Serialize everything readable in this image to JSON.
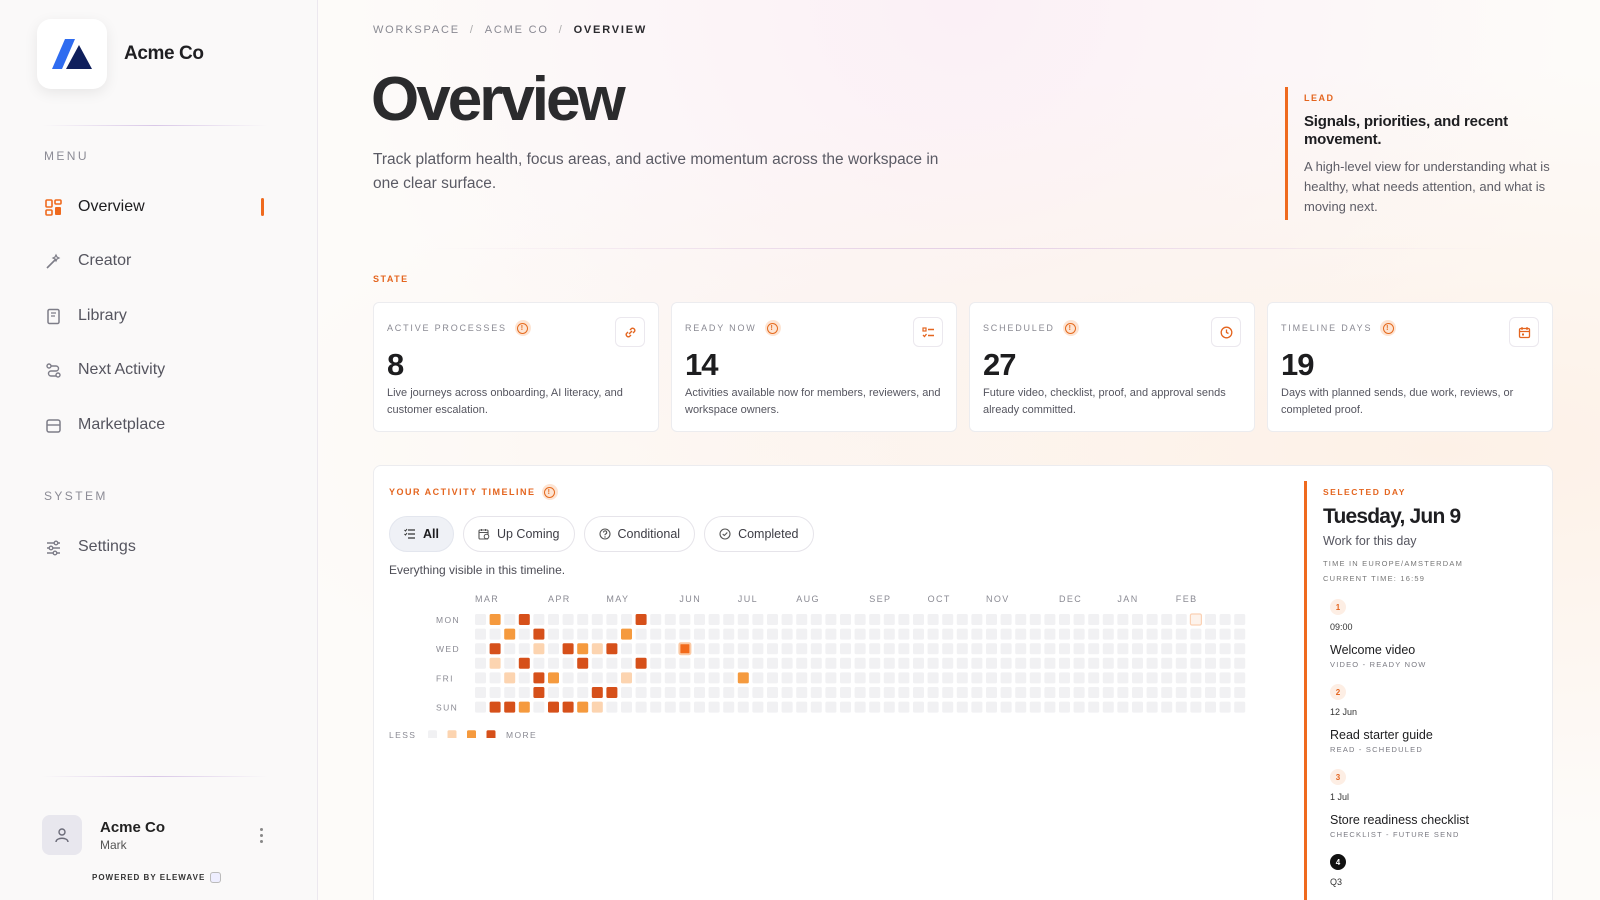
{
  "brand": {
    "name": "Acme Co"
  },
  "sidebar": {
    "menu_label": "MENU",
    "system_label": "SYSTEM",
    "items": [
      {
        "label": "Overview",
        "icon": "grid-icon"
      },
      {
        "label": "Creator",
        "icon": "wand-icon"
      },
      {
        "label": "Library",
        "icon": "book-icon"
      },
      {
        "label": "Next Activity",
        "icon": "route-icon"
      },
      {
        "label": "Marketplace",
        "icon": "store-icon"
      }
    ],
    "system_items": [
      {
        "label": "Settings",
        "icon": "sliders-icon"
      }
    ],
    "active_index": 0,
    "user": {
      "name": "Acme Co",
      "role": "Mark"
    },
    "powered_by": "POWERED BY ELEWAVE"
  },
  "breadcrumb": [
    "WORKSPACE",
    "/",
    "ACME CO",
    "/",
    "OVERVIEW"
  ],
  "page": {
    "title": "Overview",
    "subtitle": "Track platform health, focus areas, and active momentum across the workspace in one clear surface."
  },
  "lead": {
    "tag": "LEAD",
    "heading": "Signals, priorities, and recent movement.",
    "body": "A high-level view for understanding what is healthy, what needs attention, and what is moving next."
  },
  "state": {
    "label": "STATE",
    "cards": [
      {
        "label": "ACTIVE PROCESSES",
        "value": "8",
        "desc": "Live journeys across onboarding, AI literacy, and customer escalation.",
        "icon": "link-icon"
      },
      {
        "label": "READY NOW",
        "value": "14",
        "desc": "Activities available now for members, reviewers, and workspace owners.",
        "icon": "checklist-icon"
      },
      {
        "label": "SCHEDULED",
        "value": "27",
        "desc": "Future video, checklist, proof, and approval sends already committed.",
        "icon": "clock-icon"
      },
      {
        "label": "TIMELINE DAYS",
        "value": "19",
        "desc": "Days with planned sends, due work, reviews, or completed proof.",
        "icon": "calendar-icon"
      }
    ]
  },
  "timeline": {
    "label": "YOUR ACTIVITY TIMELINE",
    "filters": [
      {
        "label": "All",
        "icon": "list-icon"
      },
      {
        "label": "Up Coming",
        "icon": "calendar-clock-icon"
      },
      {
        "label": "Conditional",
        "icon": "question-circle-icon"
      },
      {
        "label": "Completed",
        "icon": "check-circle-icon"
      }
    ],
    "active_filter": 0,
    "note": "Everything visible in this timeline.",
    "months": [
      {
        "label": "MAR",
        "week": 0
      },
      {
        "label": "APR",
        "week": 5
      },
      {
        "label": "MAY",
        "week": 9
      },
      {
        "label": "JUN",
        "week": 14
      },
      {
        "label": "JUL",
        "week": 18
      },
      {
        "label": "AUG",
        "week": 22
      },
      {
        "label": "SEP",
        "week": 27
      },
      {
        "label": "OCT",
        "week": 31
      },
      {
        "label": "NOV",
        "week": 35
      },
      {
        "label": "DEC",
        "week": 40
      },
      {
        "label": "JAN",
        "week": 44
      },
      {
        "label": "FEB",
        "week": 48
      }
    ],
    "days": [
      "MON",
      "",
      "WED",
      "",
      "FRI",
      "",
      "SUN"
    ],
    "weeks": 53,
    "legend": {
      "less": "LESS",
      "more": "MORE"
    },
    "level_colors": [
      "#f1f1f3",
      "#fcd4b0",
      "#f59a3e",
      "#d6501a"
    ],
    "selected_cell_color": "#f26a1b",
    "selected_cell": {
      "week": 14,
      "day": 2
    },
    "future_cell": {
      "week": 49,
      "day": 0
    },
    "activity": [
      {
        "week": 1,
        "day": 0,
        "level": 2
      },
      {
        "week": 3,
        "day": 0,
        "level": 3
      },
      {
        "week": 11,
        "day": 0,
        "level": 3
      },
      {
        "week": 2,
        "day": 1,
        "level": 2
      },
      {
        "week": 4,
        "day": 1,
        "level": 3
      },
      {
        "week": 10,
        "day": 1,
        "level": 2
      },
      {
        "week": 1,
        "day": 2,
        "level": 3
      },
      {
        "week": 4,
        "day": 2,
        "level": 1
      },
      {
        "week": 6,
        "day": 2,
        "level": 3
      },
      {
        "week": 7,
        "day": 2,
        "level": 2
      },
      {
        "week": 8,
        "day": 2,
        "level": 1
      },
      {
        "week": 9,
        "day": 2,
        "level": 3
      },
      {
        "week": 1,
        "day": 3,
        "level": 1
      },
      {
        "week": 3,
        "day": 3,
        "level": 3
      },
      {
        "week": 7,
        "day": 3,
        "level": 3
      },
      {
        "week": 11,
        "day": 3,
        "level": 3
      },
      {
        "week": 2,
        "day": 4,
        "level": 1
      },
      {
        "week": 4,
        "day": 4,
        "level": 3
      },
      {
        "week": 5,
        "day": 4,
        "level": 2
      },
      {
        "week": 10,
        "day": 4,
        "level": 1
      },
      {
        "week": 18,
        "day": 4,
        "level": 2
      },
      {
        "week": 4,
        "day": 5,
        "level": 3
      },
      {
        "week": 8,
        "day": 5,
        "level": 3
      },
      {
        "week": 9,
        "day": 5,
        "level": 3
      },
      {
        "week": 1,
        "day": 6,
        "level": 3
      },
      {
        "week": 2,
        "day": 6,
        "level": 3
      },
      {
        "week": 3,
        "day": 6,
        "level": 2
      },
      {
        "week": 5,
        "day": 6,
        "level": 3
      },
      {
        "week": 6,
        "day": 6,
        "level": 3
      },
      {
        "week": 7,
        "day": 6,
        "level": 2
      },
      {
        "week": 8,
        "day": 6,
        "level": 1
      }
    ]
  },
  "selected_day": {
    "tag": "SELECTED DAY",
    "date": "Tuesday, Jun 9",
    "sub": "Work for this day",
    "tz": "TIME IN EUROPE/AMSTERDAM",
    "now": "CURRENT TIME: 16:59",
    "items": [
      {
        "num": "1",
        "when": "09:00",
        "title": "Welcome video",
        "meta": "VIDEO - READY NOW"
      },
      {
        "num": "2",
        "when": "12 Jun",
        "title": "Read starter guide",
        "meta": "READ - SCHEDULED"
      },
      {
        "num": "3",
        "when": "1 Jul",
        "title": "Store readiness checklist",
        "meta": "CHECKLIST - FUTURE SEND"
      },
      {
        "num": "4",
        "when": "Q3",
        "title": "",
        "meta": ""
      }
    ]
  },
  "colors": {
    "accent": "#ef6a1e",
    "text": "#1d1d1f",
    "muted": "#5a5a64"
  }
}
